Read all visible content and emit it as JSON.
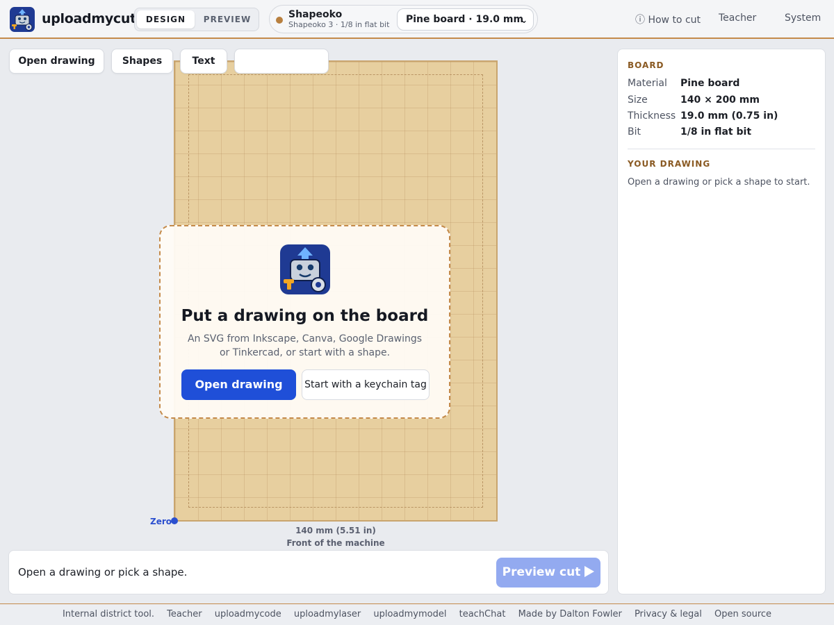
{
  "header": {
    "brand": "uploadmycut",
    "modes": [
      "DESIGN",
      "PREVIEW"
    ],
    "active_mode": "DESIGN",
    "machine": {
      "name": "Shapeoko",
      "detail": "Shapeoko 3 · 1/8 in flat bit",
      "dot_color": "#b8803f"
    },
    "board_select": {
      "selected": "Pine board · 19.0 mm"
    },
    "nav": {
      "how_to_cut": "ⓘ How to cut",
      "teacher": "Teacher",
      "system": "System"
    }
  },
  "toolbar": {
    "open_drawing": "Open drawing",
    "shapes": "Shapes",
    "text": "Text",
    "blank": ""
  },
  "canvas": {
    "zero_label": "Zero",
    "width_label": "140 mm (5.51 in)",
    "front_label": "Front of the machine"
  },
  "empty_state": {
    "title": "Put a drawing on the board",
    "subtitle": "An SVG from Inkscape, Canva, Google Drawings or Tinkercad, or start with a shape.",
    "primary_button": "Open drawing",
    "secondary_button": "Start with a keychain tag"
  },
  "statusbar": {
    "message": "Open a drawing or pick a shape.",
    "preview_button": "Preview cut"
  },
  "panel": {
    "board_heading": "BOARD",
    "properties": [
      {
        "label": "Material",
        "value": "Pine board"
      },
      {
        "label": "Size",
        "value": "140 × 200 mm"
      },
      {
        "label": "Thickness",
        "value": "19.0 mm (0.75 in)"
      },
      {
        "label": "Bit",
        "value": "1/8 in flat bit"
      }
    ],
    "drawing_heading": "YOUR DRAWING",
    "drawing_note": "Open a drawing or pick a shape to start."
  },
  "footer": {
    "links": [
      "Internal district tool.",
      "Teacher",
      "uploadmycode",
      "uploadmylaser",
      "uploadmymodel",
      "teachChat",
      "Made by Dalton Fowler",
      "Privacy & legal",
      "Open source"
    ]
  },
  "colors": {
    "accent": "#1f4fd8",
    "brand_brown": "#c48a4a",
    "board_wood": "#e7cf9f",
    "preview_disabled": "#93aaf0"
  }
}
